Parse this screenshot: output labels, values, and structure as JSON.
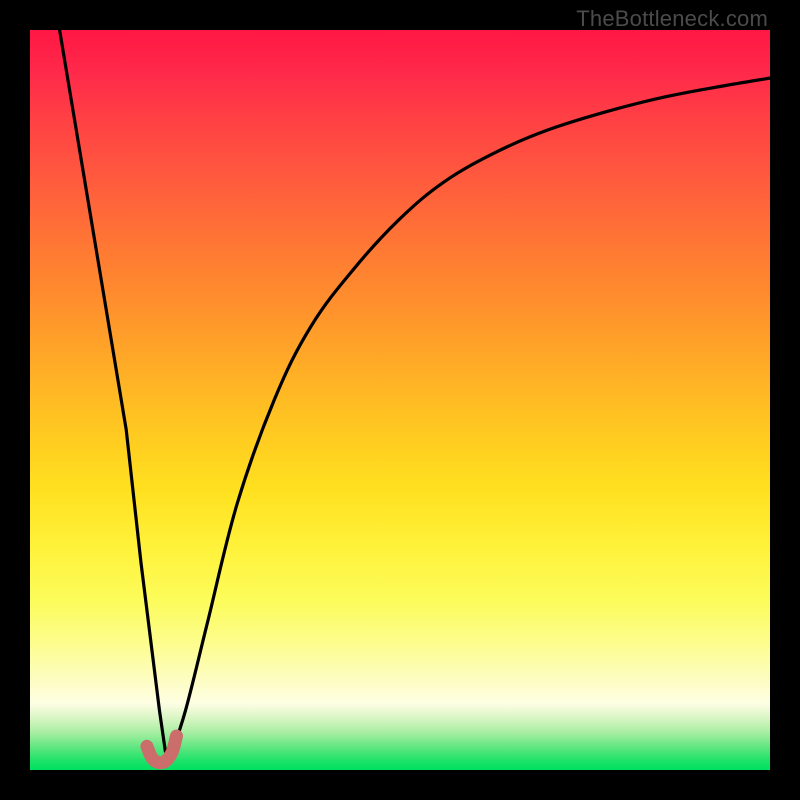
{
  "watermark": {
    "text": "TheBottleneck.com"
  },
  "colors": {
    "page_bg": "#000000",
    "gradient_top": "#ff1744",
    "gradient_mid": "#ffd21f",
    "gradient_bottom": "#00e060",
    "curve_stroke": "#000000",
    "highlight_stroke": "#cb6e6b"
  },
  "chart_data": {
    "type": "line",
    "title": "",
    "xlabel": "",
    "ylabel": "",
    "xlim": [
      0,
      100
    ],
    "ylim": [
      0,
      100
    ],
    "grid": false,
    "legend": false,
    "note": "Values traced from pixel geometry. x and y are 0–100 percent of the plot area; y=0 is the bottom (green) and y=100 is the top (red). The relevant quantity appears to be a bottleneck percentage that dips to ~0 near x≈18.",
    "series": [
      {
        "name": "descending-branch",
        "x": [
          4.0,
          7.0,
          10.0,
          13.0,
          15.0,
          16.5,
          17.5,
          18.3
        ],
        "y": [
          100.0,
          82.0,
          64.0,
          46.0,
          28.0,
          16.0,
          8.0,
          2.5
        ]
      },
      {
        "name": "ascending-branch",
        "x": [
          19.0,
          21.0,
          24.0,
          28.0,
          33.0,
          38.0,
          44.0,
          50.0,
          56.0,
          63.0,
          70.0,
          78.0,
          86.0,
          94.0,
          100.0
        ],
        "y": [
          2.0,
          8.0,
          20.0,
          36.0,
          50.0,
          60.0,
          68.0,
          74.5,
          79.5,
          83.5,
          86.5,
          89.0,
          91.0,
          92.5,
          93.5
        ]
      },
      {
        "name": "highlight-hook",
        "comment": "Small pink J-shaped mark at the valley minimum.",
        "x": [
          15.8,
          16.5,
          17.4,
          18.3,
          19.2,
          19.8
        ],
        "y": [
          3.2,
          1.6,
          1.0,
          1.2,
          2.4,
          4.6
        ]
      }
    ]
  }
}
